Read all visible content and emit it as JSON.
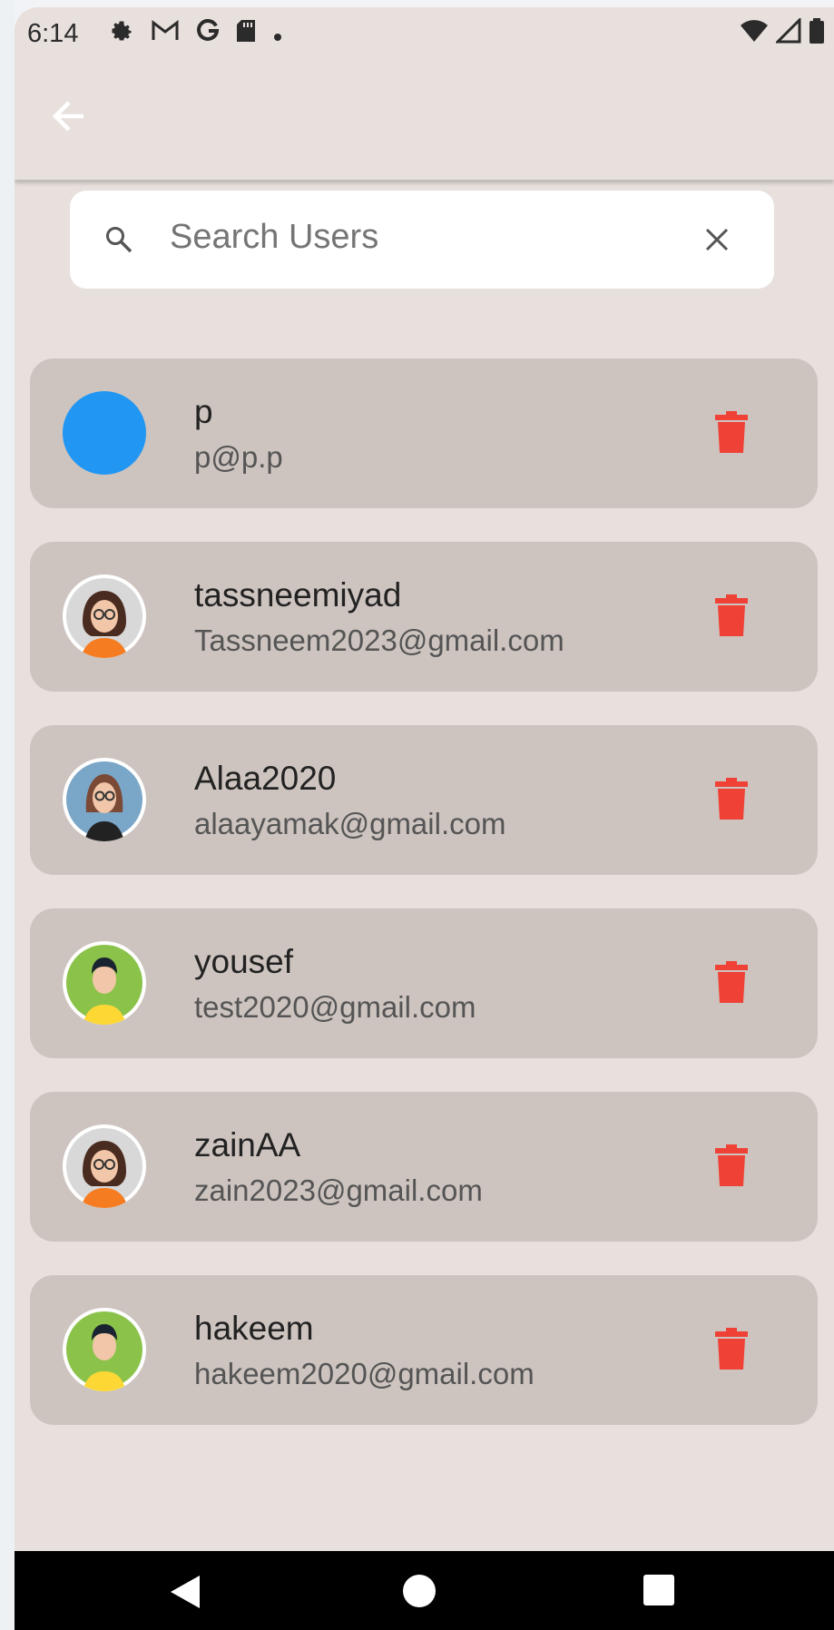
{
  "status_bar": {
    "time": "6:14"
  },
  "search": {
    "placeholder": "Search Users"
  },
  "users": [
    {
      "name": "p",
      "email": "p@p.p",
      "avatar": "blue-circle"
    },
    {
      "name": "tassneemiyad",
      "email": "Tassneem2023@gmail.com",
      "avatar": "female-glasses-avatar"
    },
    {
      "name": "Alaa2020",
      "email": "alaayamak@gmail.com",
      "avatar": "female-avatar-blue-bg"
    },
    {
      "name": "yousef",
      "email": "test2020@gmail.com",
      "avatar": "male-avatar-green-bg"
    },
    {
      "name": "zainAA",
      "email": "zain2023@gmail.com",
      "avatar": "female-glasses-avatar"
    },
    {
      "name": "hakeem",
      "email": "hakeem2020@gmail.com",
      "avatar": "male-avatar-green-bg"
    }
  ],
  "colors": {
    "background": "#e8e0dc",
    "card": "#cdc4bf",
    "delete": "#ef4136",
    "avatar_blue": "#2196f3"
  }
}
